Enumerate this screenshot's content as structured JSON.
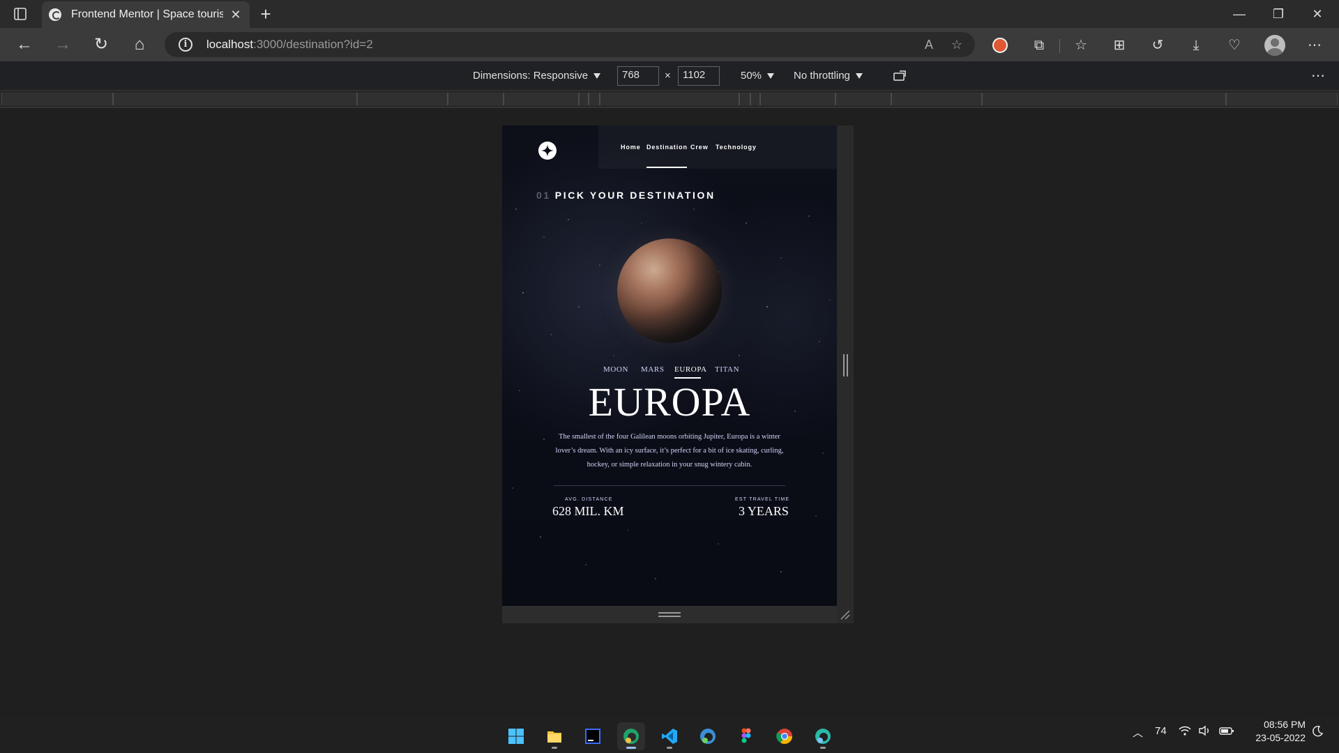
{
  "browser": {
    "tab_title": "Frontend Mentor | Space tourism website",
    "url_host": "localhost",
    "url_path": ":3000/destination?id=2"
  },
  "devtools": {
    "dimensions_label": "Dimensions: Responsive",
    "width": "768",
    "height": "1102",
    "times": "×",
    "zoom": "50%",
    "throttling": "No throttling",
    "more": "⋯"
  },
  "site": {
    "nav": [
      "Home",
      "Destination",
      "Crew",
      "Technology"
    ],
    "active_nav": "Destination",
    "heading_number": "01",
    "heading_text": "PICK YOUR DESTINATION",
    "tabs": [
      "MOON",
      "MARS",
      "EUROPA",
      "TITAN"
    ],
    "active_tab": "EUROPA",
    "destination_name": "EUROPA",
    "description": "The smallest of the four Galilean moons orbiting Jupiter, Europa is a winter lover’s dream. With an icy surface, it’s perfect for a bit of ice skating, curling, hockey, or simple relaxation in your snug wintery cabin.",
    "distance_label": "AVG. DISTANCE",
    "distance_value": "628 MIL. KM",
    "travel_label": "EST TRAVEL TIME",
    "travel_value": "3 YEARS"
  },
  "taskbar": {
    "apps": [
      "windows-start",
      "file-explorer",
      "intellij",
      "edge-canary",
      "vscode",
      "edge-dev",
      "figma",
      "chrome",
      "edge-beta"
    ],
    "tray_count": "74",
    "time": "08:56 PM",
    "date": "23-05-2022"
  },
  "colors": {
    "page_bg": "#0b0d17",
    "accent_text": "#d0d6f9",
    "browser_chrome": "#3b3b3b"
  }
}
